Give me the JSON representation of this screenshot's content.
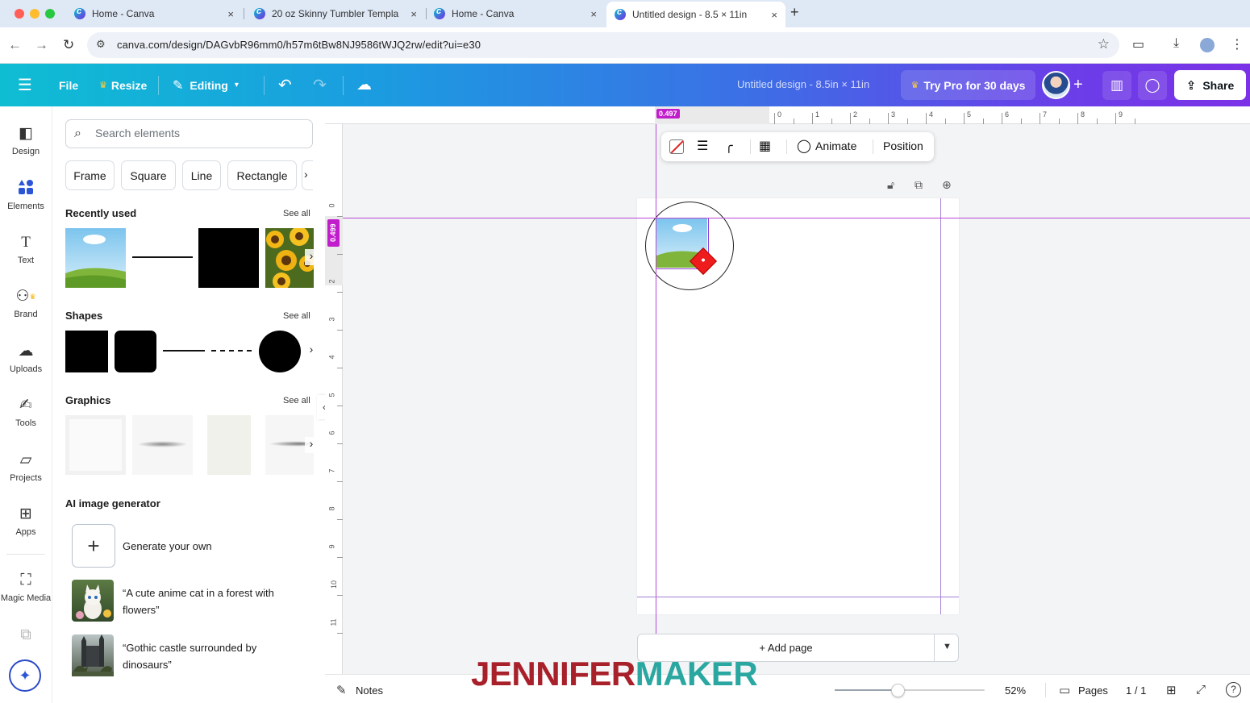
{
  "browser": {
    "tabs": [
      {
        "label": "Home - Canva",
        "active": false
      },
      {
        "label": "20 oz Skinny Tumbler Templa",
        "active": false
      },
      {
        "label": "Home - Canva",
        "active": false
      },
      {
        "label": "Untitled design - 8.5 × 11in",
        "active": true
      }
    ],
    "close_glyph": "×",
    "new_tab_glyph": "+",
    "url": "canva.com/design/DAGvbR96mm0/h57m6tBw8NJ9586tWJQ2rw/edit?ui=e30"
  },
  "header": {
    "file_label": "File",
    "resize_label": "Resize",
    "editing_label": "Editing",
    "doc_title": "Untitled design - 8.5in × 11in",
    "try_pro_label": "Try Pro for 30 days",
    "share_label": "Share"
  },
  "rail": {
    "items": [
      {
        "label": "Design",
        "icon": "design-icon"
      },
      {
        "label": "Elements",
        "icon": "elements-icon",
        "active": true
      },
      {
        "label": "Text",
        "icon": "text-icon"
      },
      {
        "label": "Brand",
        "icon": "brand-icon"
      },
      {
        "label": "Uploads",
        "icon": "uploads-icon"
      },
      {
        "label": "Tools",
        "icon": "tools-icon"
      },
      {
        "label": "Projects",
        "icon": "projects-icon"
      },
      {
        "label": "Apps",
        "icon": "apps-icon"
      },
      {
        "label": "Magic Media",
        "icon": "magic-media-icon"
      }
    ]
  },
  "panel": {
    "search_placeholder": "Search elements",
    "chips": [
      "Frame",
      "Square",
      "Line",
      "Rectangle"
    ],
    "recently_used_title": "Recently used",
    "shapes_title": "Shapes",
    "graphics_title": "Graphics",
    "see_all": "See all",
    "ai_title": "AI image generator",
    "ai_items": [
      {
        "label": "Generate your own"
      },
      {
        "label": "“A cute anime cat in a forest with flowers”"
      },
      {
        "label": "“Gothic castle surrounded by dinosaurs”"
      }
    ]
  },
  "canvas": {
    "ruler_x_badge": "0.497",
    "ruler_y_badge": "0.499",
    "ruler_top_numbers": [
      "0",
      "1",
      "2",
      "3",
      "4",
      "5",
      "6",
      "7",
      "8",
      "9"
    ],
    "ruler_left_numbers": [
      "0",
      "1",
      "2",
      "3",
      "4",
      "5",
      "6",
      "7",
      "8",
      "9",
      "10",
      "11"
    ],
    "toolbar": {
      "animate_label": "Animate",
      "position_label": "Position"
    },
    "add_page_label": "+ Add page"
  },
  "bottombar": {
    "notes_label": "Notes",
    "zoom_value": "52%",
    "zoom_fraction": 0.42,
    "pages_label": "Pages",
    "page_count": "1 / 1"
  },
  "watermark": {
    "part1": "JENNIFER",
    "part2": "MAKER"
  },
  "colors": {
    "accent_blue": "#2c55d6",
    "guide_magenta": "#c21dcc"
  }
}
